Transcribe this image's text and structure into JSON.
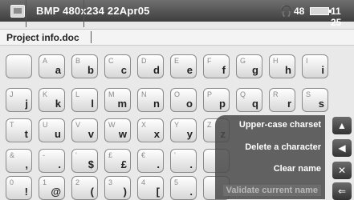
{
  "status": {
    "title": "BMP 480x234 22Apr05",
    "volume": "48",
    "time": "11 25"
  },
  "filename": "Project info.doc",
  "keyboard": {
    "rows": [
      [
        {
          "sub": "",
          "main": ""
        },
        {
          "sub": "A",
          "main": "a"
        },
        {
          "sub": "B",
          "main": "b"
        },
        {
          "sub": "C",
          "main": "c"
        },
        {
          "sub": "D",
          "main": "d"
        },
        {
          "sub": "E",
          "main": "e"
        },
        {
          "sub": "F",
          "main": "f"
        },
        {
          "sub": "G",
          "main": "g"
        },
        {
          "sub": "H",
          "main": "h"
        },
        {
          "sub": "I",
          "main": "i"
        }
      ],
      [
        {
          "sub": "J",
          "main": "j"
        },
        {
          "sub": "K",
          "main": "k"
        },
        {
          "sub": "L",
          "main": "l"
        },
        {
          "sub": "M",
          "main": "m"
        },
        {
          "sub": "N",
          "main": "n"
        },
        {
          "sub": "O",
          "main": "o"
        },
        {
          "sub": "P",
          "main": "p"
        },
        {
          "sub": "Q",
          "main": "q"
        },
        {
          "sub": "R",
          "main": "r"
        },
        {
          "sub": "S",
          "main": "s"
        }
      ],
      [
        {
          "sub": "T",
          "main": "t"
        },
        {
          "sub": "U",
          "main": "u"
        },
        {
          "sub": "V",
          "main": "v"
        },
        {
          "sub": "W",
          "main": "w"
        },
        {
          "sub": "X",
          "main": "x"
        },
        {
          "sub": "Y",
          "main": "y"
        },
        {
          "sub": "Z",
          "main": "z"
        }
      ],
      [
        {
          "sub": "&",
          "main": ","
        },
        {
          "sub": "-",
          "main": "."
        },
        {
          "sub": "'",
          "main": "$"
        },
        {
          "sub": "£",
          "main": "£"
        },
        {
          "sub": "€",
          "main": "."
        },
        {
          "sub": "'",
          "main": "."
        },
        {
          "sub": "",
          "main": ""
        }
      ],
      [
        {
          "sub": "0",
          "main": "!"
        },
        {
          "sub": "1",
          "main": "@"
        },
        {
          "sub": "2",
          "main": "("
        },
        {
          "sub": "3",
          "main": ")"
        },
        {
          "sub": "4",
          "main": "["
        },
        {
          "sub": "5",
          "main": "."
        },
        {
          "sub": "",
          "main": ""
        }
      ]
    ]
  },
  "menu": {
    "items": [
      {
        "label": "Upper-case charset",
        "enabled": true
      },
      {
        "label": "Delete a character",
        "enabled": true
      },
      {
        "label": "Clear name",
        "enabled": true
      },
      {
        "label": "Validate current name",
        "enabled": false
      }
    ]
  },
  "icons": {
    "app": "bmp-icon",
    "volume": "headphones-icon",
    "battery": "battery-icon",
    "side": [
      "up-arrow-icon",
      "left-arrow-icon",
      "close-icon",
      "back-arrow-icon"
    ]
  }
}
